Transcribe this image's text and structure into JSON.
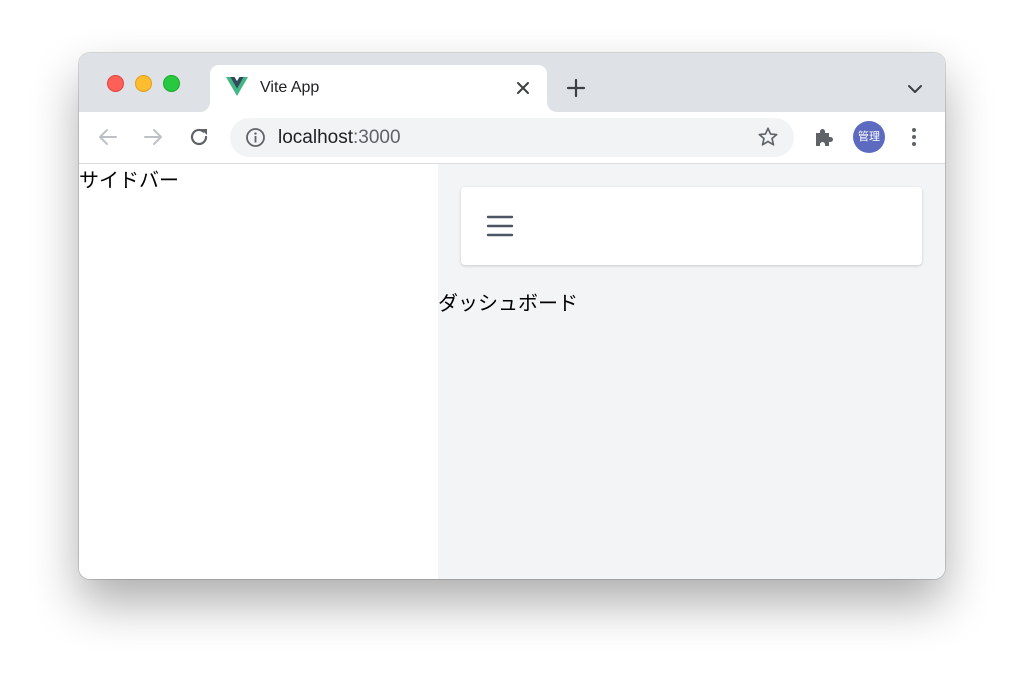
{
  "browser": {
    "tab": {
      "title": "Vite App",
      "favicon": "vue-logo-icon"
    },
    "address": {
      "host": "localhost",
      "port": ":3000"
    },
    "profile": {
      "label": "管理",
      "color": "#5c6bc0"
    },
    "colors": {
      "tabstrip": "#dee1e6",
      "omnibox": "#f1f3f4"
    }
  },
  "page": {
    "sidebar": {
      "label": "サイドバー"
    },
    "main": {
      "title": "ダッシュボード",
      "background": "#f3f4f6"
    },
    "header": {
      "menu_icon": "hamburger-menu-icon"
    }
  }
}
